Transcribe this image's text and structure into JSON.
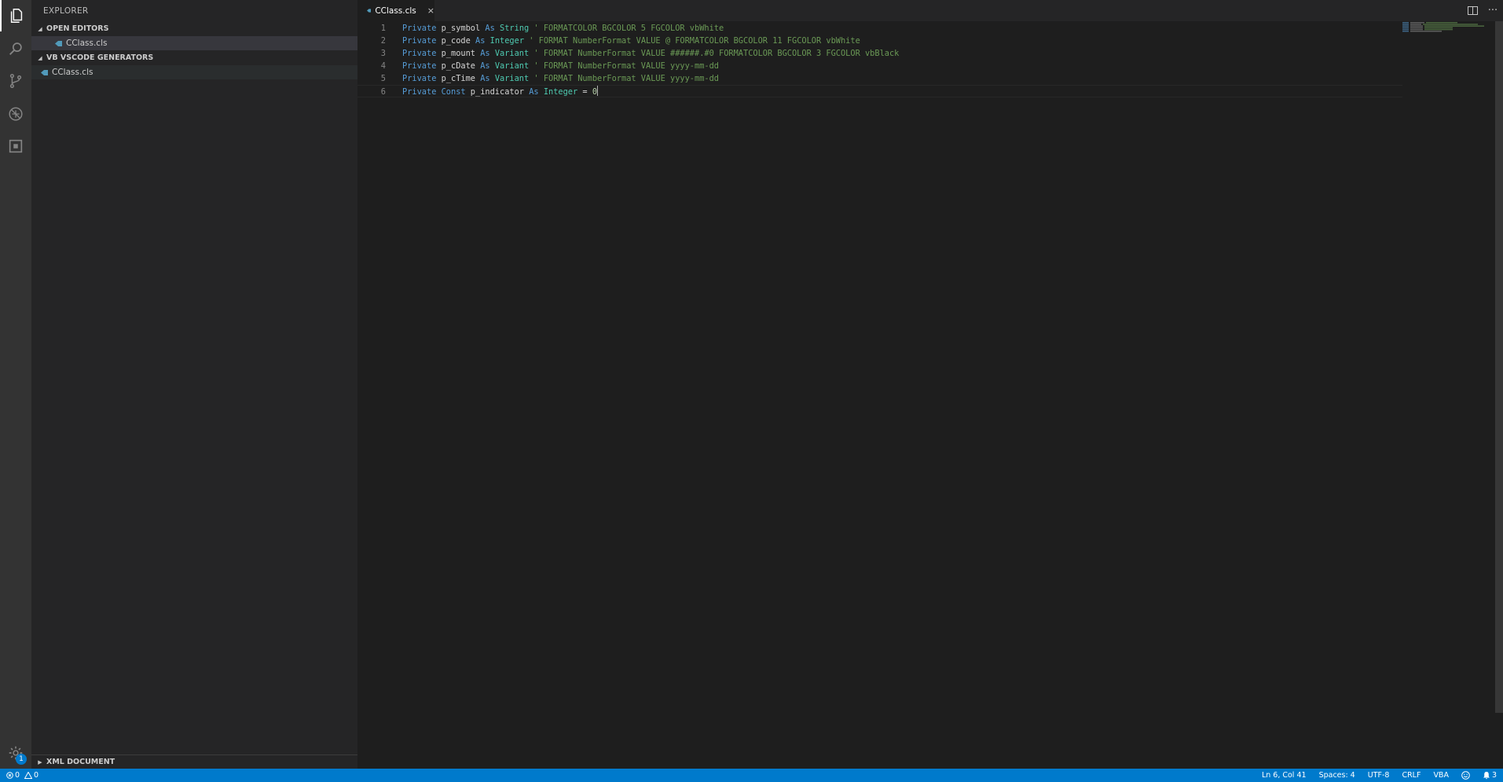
{
  "sidebar": {
    "title": "EXPLORER",
    "open_editors_label": "OPEN EDITORS",
    "open_editors_file": "CClass.cls",
    "project_label": "VB VSCODE GENERATORS",
    "project_file": "CClass.cls",
    "xml_label": "XML DOCUMENT"
  },
  "activity": {
    "settings_badge": "1"
  },
  "tab": {
    "label": "CClass.cls",
    "close": "×"
  },
  "tab_actions": {
    "more": "···"
  },
  "code_lines": [
    {
      "n": "1",
      "t": [
        [
          "kw",
          "Private"
        ],
        [
          "pl",
          " p_symbol "
        ],
        [
          "kw",
          "As"
        ],
        [
          "pl",
          " "
        ],
        [
          "ty",
          "String"
        ],
        [
          "pl",
          " "
        ],
        [
          "cm",
          "' FORMATCOLOR BGCOLOR 5 FGCOLOR vbWhite"
        ]
      ]
    },
    {
      "n": "2",
      "t": [
        [
          "kw",
          "Private"
        ],
        [
          "pl",
          " p_code "
        ],
        [
          "kw",
          "As"
        ],
        [
          "pl",
          " "
        ],
        [
          "ty",
          "Integer"
        ],
        [
          "pl",
          " "
        ],
        [
          "cm",
          "' FORMAT NumberFormat VALUE @ FORMATCOLOR BGCOLOR 11 FGCOLOR vbWhite"
        ]
      ]
    },
    {
      "n": "3",
      "t": [
        [
          "kw",
          "Private"
        ],
        [
          "pl",
          " p_mount "
        ],
        [
          "kw",
          "As"
        ],
        [
          "pl",
          " "
        ],
        [
          "ty",
          "Variant"
        ],
        [
          "pl",
          " "
        ],
        [
          "cm",
          "' FORMAT NumberFormat VALUE ######.#0 FORMATCOLOR BGCOLOR 3 FGCOLOR vbBlack"
        ]
      ]
    },
    {
      "n": "4",
      "t": [
        [
          "kw",
          "Private"
        ],
        [
          "pl",
          " p_cDate "
        ],
        [
          "kw",
          "As"
        ],
        [
          "pl",
          " "
        ],
        [
          "ty",
          "Variant"
        ],
        [
          "pl",
          " "
        ],
        [
          "cm",
          "' FORMAT NumberFormat VALUE yyyy-mm-dd"
        ]
      ]
    },
    {
      "n": "5",
      "t": [
        [
          "kw",
          "Private"
        ],
        [
          "pl",
          " p_cTime "
        ],
        [
          "kw",
          "As"
        ],
        [
          "pl",
          " "
        ],
        [
          "ty",
          "Variant"
        ],
        [
          "pl",
          " "
        ],
        [
          "cm",
          "' FORMAT NumberFormat VALUE yyyy-mm-dd"
        ]
      ]
    },
    {
      "n": "6",
      "t": [
        [
          "kw",
          "Private"
        ],
        [
          "pl",
          " "
        ],
        [
          "kw",
          "Const"
        ],
        [
          "pl",
          " p_indicator "
        ],
        [
          "kw",
          "As"
        ],
        [
          "pl",
          " "
        ],
        [
          "ty",
          "Integer"
        ],
        [
          "pl",
          " = "
        ],
        [
          "num",
          "0"
        ]
      ]
    }
  ],
  "status": {
    "errors": "0",
    "warnings": "0",
    "position": "Ln 6, Col 41",
    "spaces": "Spaces: 4",
    "encoding": "UTF-8",
    "eol": "CRLF",
    "language": "VBA",
    "notifications": "3"
  },
  "colors": {
    "accent": "#007acc",
    "keyword": "#569cd6",
    "type": "#4ec9b0",
    "comment": "#6a9955",
    "file_icon": "#519aba"
  },
  "icons": [
    "files-icon",
    "search-icon",
    "source-control-icon",
    "debug-icon",
    "extensions-icon",
    "gear-icon"
  ]
}
